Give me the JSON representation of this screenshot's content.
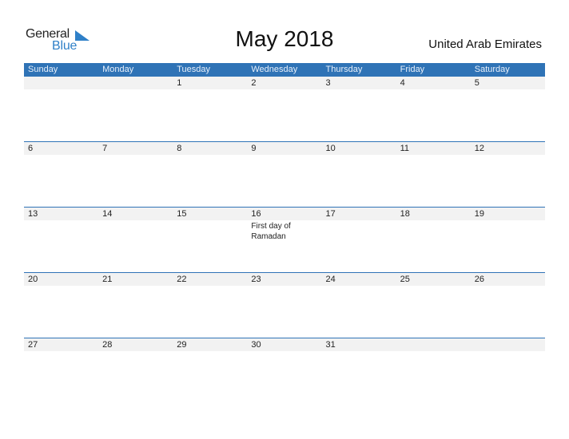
{
  "logo": {
    "word1": "General",
    "word2": "Blue"
  },
  "header": {
    "title": "May 2018",
    "country": "United Arab Emirates"
  },
  "colors": {
    "accent": "#2f73b6",
    "date_band": "#f2f2f2",
    "logo_blue": "#2f80c8"
  },
  "days_of_week": [
    "Sunday",
    "Monday",
    "Tuesday",
    "Wednesday",
    "Thursday",
    "Friday",
    "Saturday"
  ],
  "weeks": [
    {
      "days": [
        {
          "d": "",
          "e": ""
        },
        {
          "d": "",
          "e": ""
        },
        {
          "d": "1",
          "e": ""
        },
        {
          "d": "2",
          "e": ""
        },
        {
          "d": "3",
          "e": ""
        },
        {
          "d": "4",
          "e": ""
        },
        {
          "d": "5",
          "e": ""
        }
      ]
    },
    {
      "days": [
        {
          "d": "6",
          "e": ""
        },
        {
          "d": "7",
          "e": ""
        },
        {
          "d": "8",
          "e": ""
        },
        {
          "d": "9",
          "e": ""
        },
        {
          "d": "10",
          "e": ""
        },
        {
          "d": "11",
          "e": ""
        },
        {
          "d": "12",
          "e": ""
        }
      ]
    },
    {
      "days": [
        {
          "d": "13",
          "e": ""
        },
        {
          "d": "14",
          "e": ""
        },
        {
          "d": "15",
          "e": ""
        },
        {
          "d": "16",
          "e": "First day of Ramadan"
        },
        {
          "d": "17",
          "e": ""
        },
        {
          "d": "18",
          "e": ""
        },
        {
          "d": "19",
          "e": ""
        }
      ]
    },
    {
      "days": [
        {
          "d": "20",
          "e": ""
        },
        {
          "d": "21",
          "e": ""
        },
        {
          "d": "22",
          "e": ""
        },
        {
          "d": "23",
          "e": ""
        },
        {
          "d": "24",
          "e": ""
        },
        {
          "d": "25",
          "e": ""
        },
        {
          "d": "26",
          "e": ""
        }
      ]
    },
    {
      "days": [
        {
          "d": "27",
          "e": ""
        },
        {
          "d": "28",
          "e": ""
        },
        {
          "d": "29",
          "e": ""
        },
        {
          "d": "30",
          "e": ""
        },
        {
          "d": "31",
          "e": ""
        },
        {
          "d": "",
          "e": ""
        },
        {
          "d": "",
          "e": ""
        }
      ]
    }
  ]
}
